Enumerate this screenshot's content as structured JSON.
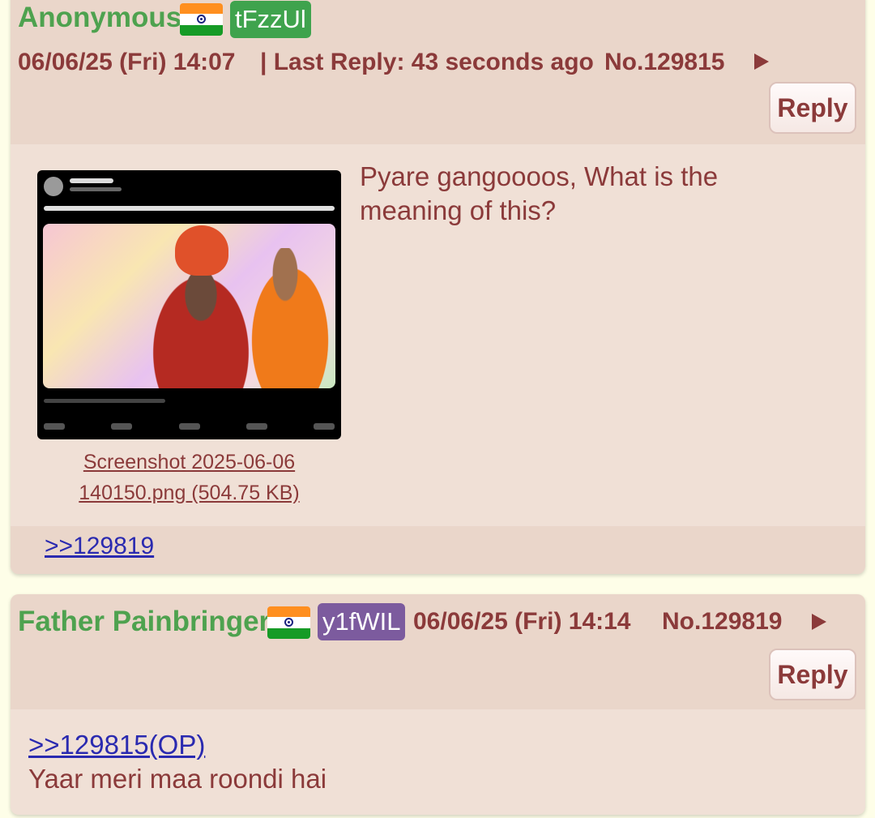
{
  "op": {
    "name": "Anonymous",
    "flag": "india-flag",
    "poster_id": "tFzzUl",
    "poster_id_color": "#3fa34d",
    "datetime": "06/06/25 (Fri) 14:07",
    "last_reply": "| Last Reply: 43 seconds ago",
    "post_number": "No.129815",
    "reply_label": "Reply",
    "file_link_line1": "Screenshot 2025-06-06",
    "file_link_line2": "140150.png (504.75 KB)",
    "comment_line1": "Pyare gangoooos, What is the",
    "comment_line2": "meaning of this?",
    "backlink": ">>129819"
  },
  "reply1": {
    "name": "Father Painbringer",
    "flag": "india-flag",
    "poster_id": "y1fWIL",
    "poster_id_color": "#7c5b9e",
    "datetime": "06/06/25 (Fri) 14:14",
    "post_number": "No.129819",
    "reply_label": "Reply",
    "quote": ">>129815(OP)",
    "comment": "Yaar meri maa roondi hai"
  },
  "colors": {
    "page_bg": "#fefee8",
    "post_bg": "#f0e0d6",
    "header_bg": "#ead6ca",
    "name": "#4ea24f",
    "meta_text": "#8b3a3a",
    "quote_link": "#2a2ab0"
  }
}
